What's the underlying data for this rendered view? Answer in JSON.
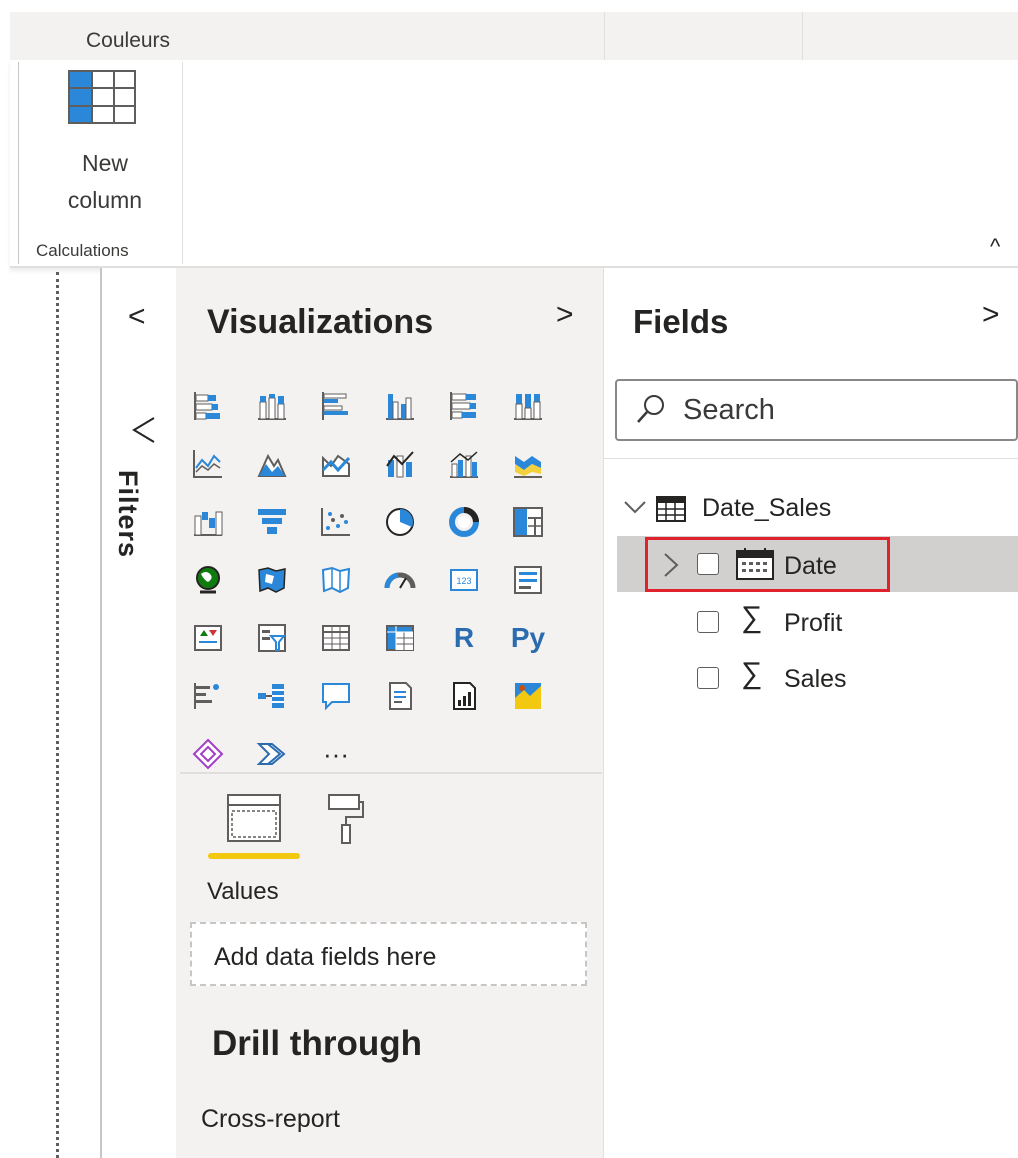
{
  "ribbon": {
    "group_colors_label": "Couleurs",
    "new_column_label": "New column",
    "calculations_group_label": "Calculations",
    "collapse_icon": "chevron-up-icon"
  },
  "filters": {
    "label": "Filters",
    "collapse_icon": "chevron-left-icon",
    "funnel_icon": "funnel-icon"
  },
  "visualizations": {
    "title": "Visualizations",
    "expand_icon": "chevron-right-icon",
    "icons": [
      "stacked-bar-chart-icon",
      "stacked-column-chart-icon",
      "clustered-bar-chart-icon",
      "clustered-column-chart-icon",
      "100-stacked-bar-chart-icon",
      "100-stacked-column-chart-icon",
      "line-chart-icon",
      "area-chart-icon",
      "stacked-area-chart-icon",
      "line-and-stacked-column-chart-icon",
      "line-and-clustered-column-chart-icon",
      "ribbon-chart-icon",
      "waterfall-chart-icon",
      "funnel-chart-icon",
      "scatter-chart-icon",
      "pie-chart-icon",
      "donut-chart-icon",
      "treemap-icon",
      "map-icon",
      "filled-map-icon",
      "shape-map-icon",
      "gauge-icon",
      "card-icon",
      "multi-row-card-icon",
      "kpi-icon",
      "slicer-icon",
      "table-icon",
      "matrix-icon",
      "r-script-visual-icon",
      "python-visual-icon",
      "key-influencers-icon",
      "decomposition-tree-icon",
      "qa-icon",
      "smart-narrative-icon",
      "paginated-report-icon",
      "arcgis-map-icon",
      "power-apps-icon",
      "power-automate-icon",
      "more-visuals-icon"
    ],
    "r_label": "R",
    "py_label": "Py",
    "more_label": "···",
    "tabs": [
      "fields-tab-icon",
      "format-tab-icon"
    ],
    "values_label": "Values",
    "drop_placeholder": "Add data fields here",
    "drill_title": "Drill through",
    "cross_report_label": "Cross-report",
    "accent_color": "#f2c811"
  },
  "fields": {
    "title": "Fields",
    "expand_icon": "chevron-right-icon",
    "search_placeholder": "Search",
    "table": {
      "name": "Date_Sales",
      "items": [
        {
          "label": "Date",
          "type": "date-hierarchy",
          "sigma": ""
        },
        {
          "label": "Profit",
          "type": "measure",
          "sigma": "∑"
        },
        {
          "label": "Sales",
          "type": "measure",
          "sigma": "∑"
        }
      ]
    },
    "highlight_color": "#e0222d"
  }
}
